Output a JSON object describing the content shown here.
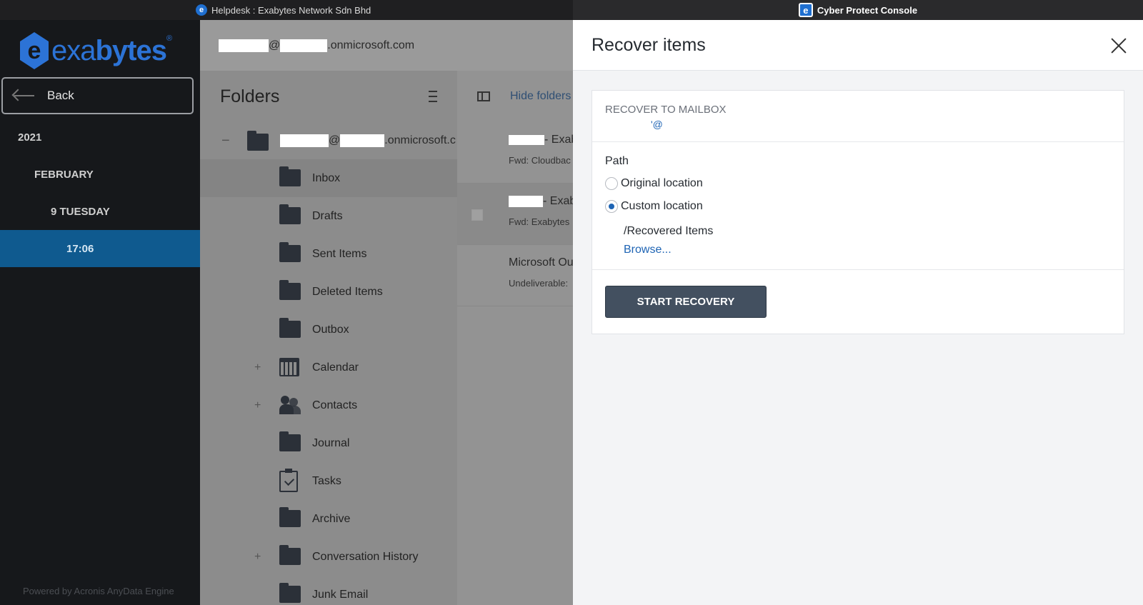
{
  "titlebar": {
    "left_title": "Helpdesk : Exabytes Network Sdn Bhd",
    "right_title": "Cyber Protect Console",
    "left_icon": "e",
    "right_icon": "e"
  },
  "sidebar": {
    "logo": {
      "icon_letter": "e",
      "text_light": "exa",
      "text_bold": "bytes",
      "reg": "®"
    },
    "back_label": "Back",
    "tree": [
      {
        "label": "2021"
      },
      {
        "label": "FEBRUARY"
      },
      {
        "label": "9 TUESDAY"
      },
      {
        "label": "17:06",
        "selected": true
      }
    ],
    "powered_by": "Powered by Acronis AnyData Engine"
  },
  "account": {
    "at": "@",
    "domain": ".onmicrosoft.com"
  },
  "folders": {
    "title": "Folders",
    "root_minus": "−",
    "root_at": "@",
    "root_domain": ".onmicrosoft.c",
    "items": [
      {
        "label": "Inbox",
        "icon": "folder-icon"
      },
      {
        "label": "Drafts",
        "icon": "folder-icon"
      },
      {
        "label": "Sent Items",
        "icon": "folder-icon"
      },
      {
        "label": "Deleted Items",
        "icon": "folder-icon"
      },
      {
        "label": "Outbox",
        "icon": "folder-icon"
      },
      {
        "label": "Calendar",
        "icon": "calendar-icon",
        "expand": "+"
      },
      {
        "label": "Contacts",
        "icon": "contacts-icon",
        "expand": "+"
      },
      {
        "label": "Journal",
        "icon": "folder-icon"
      },
      {
        "label": "Tasks",
        "icon": "tasks-icon"
      },
      {
        "label": "Archive",
        "icon": "folder-icon"
      },
      {
        "label": "Conversation History",
        "icon": "folder-icon",
        "expand": "+"
      },
      {
        "label": "Junk Email",
        "icon": "folder-icon"
      }
    ]
  },
  "messages": {
    "hide_folders": "Hide folders",
    "list": [
      {
        "sender": "- Exab",
        "subject": "Fwd: Cloudbac"
      },
      {
        "sender": "- Exab",
        "subject": "Fwd: Exabytes"
      },
      {
        "sender": "Microsoft Ou",
        "subject": "Undeliverable:"
      }
    ]
  },
  "drawer": {
    "title": "Recover items",
    "recover_to_label": "RECOVER TO MAILBOX",
    "mailbox_value": "'@",
    "path_label": "Path",
    "options": [
      {
        "label": "Original location",
        "selected": false
      },
      {
        "label": "Custom location",
        "selected": true
      }
    ],
    "custom_path": "/Recovered Items",
    "browse_label": "Browse...",
    "start_button": "START RECOVERY"
  },
  "colors": {
    "accent_blue": "#1e64b4",
    "selected_tree": "#0f5a8f",
    "button_bg": "#435060",
    "logo_blue": "#2c73d6"
  }
}
